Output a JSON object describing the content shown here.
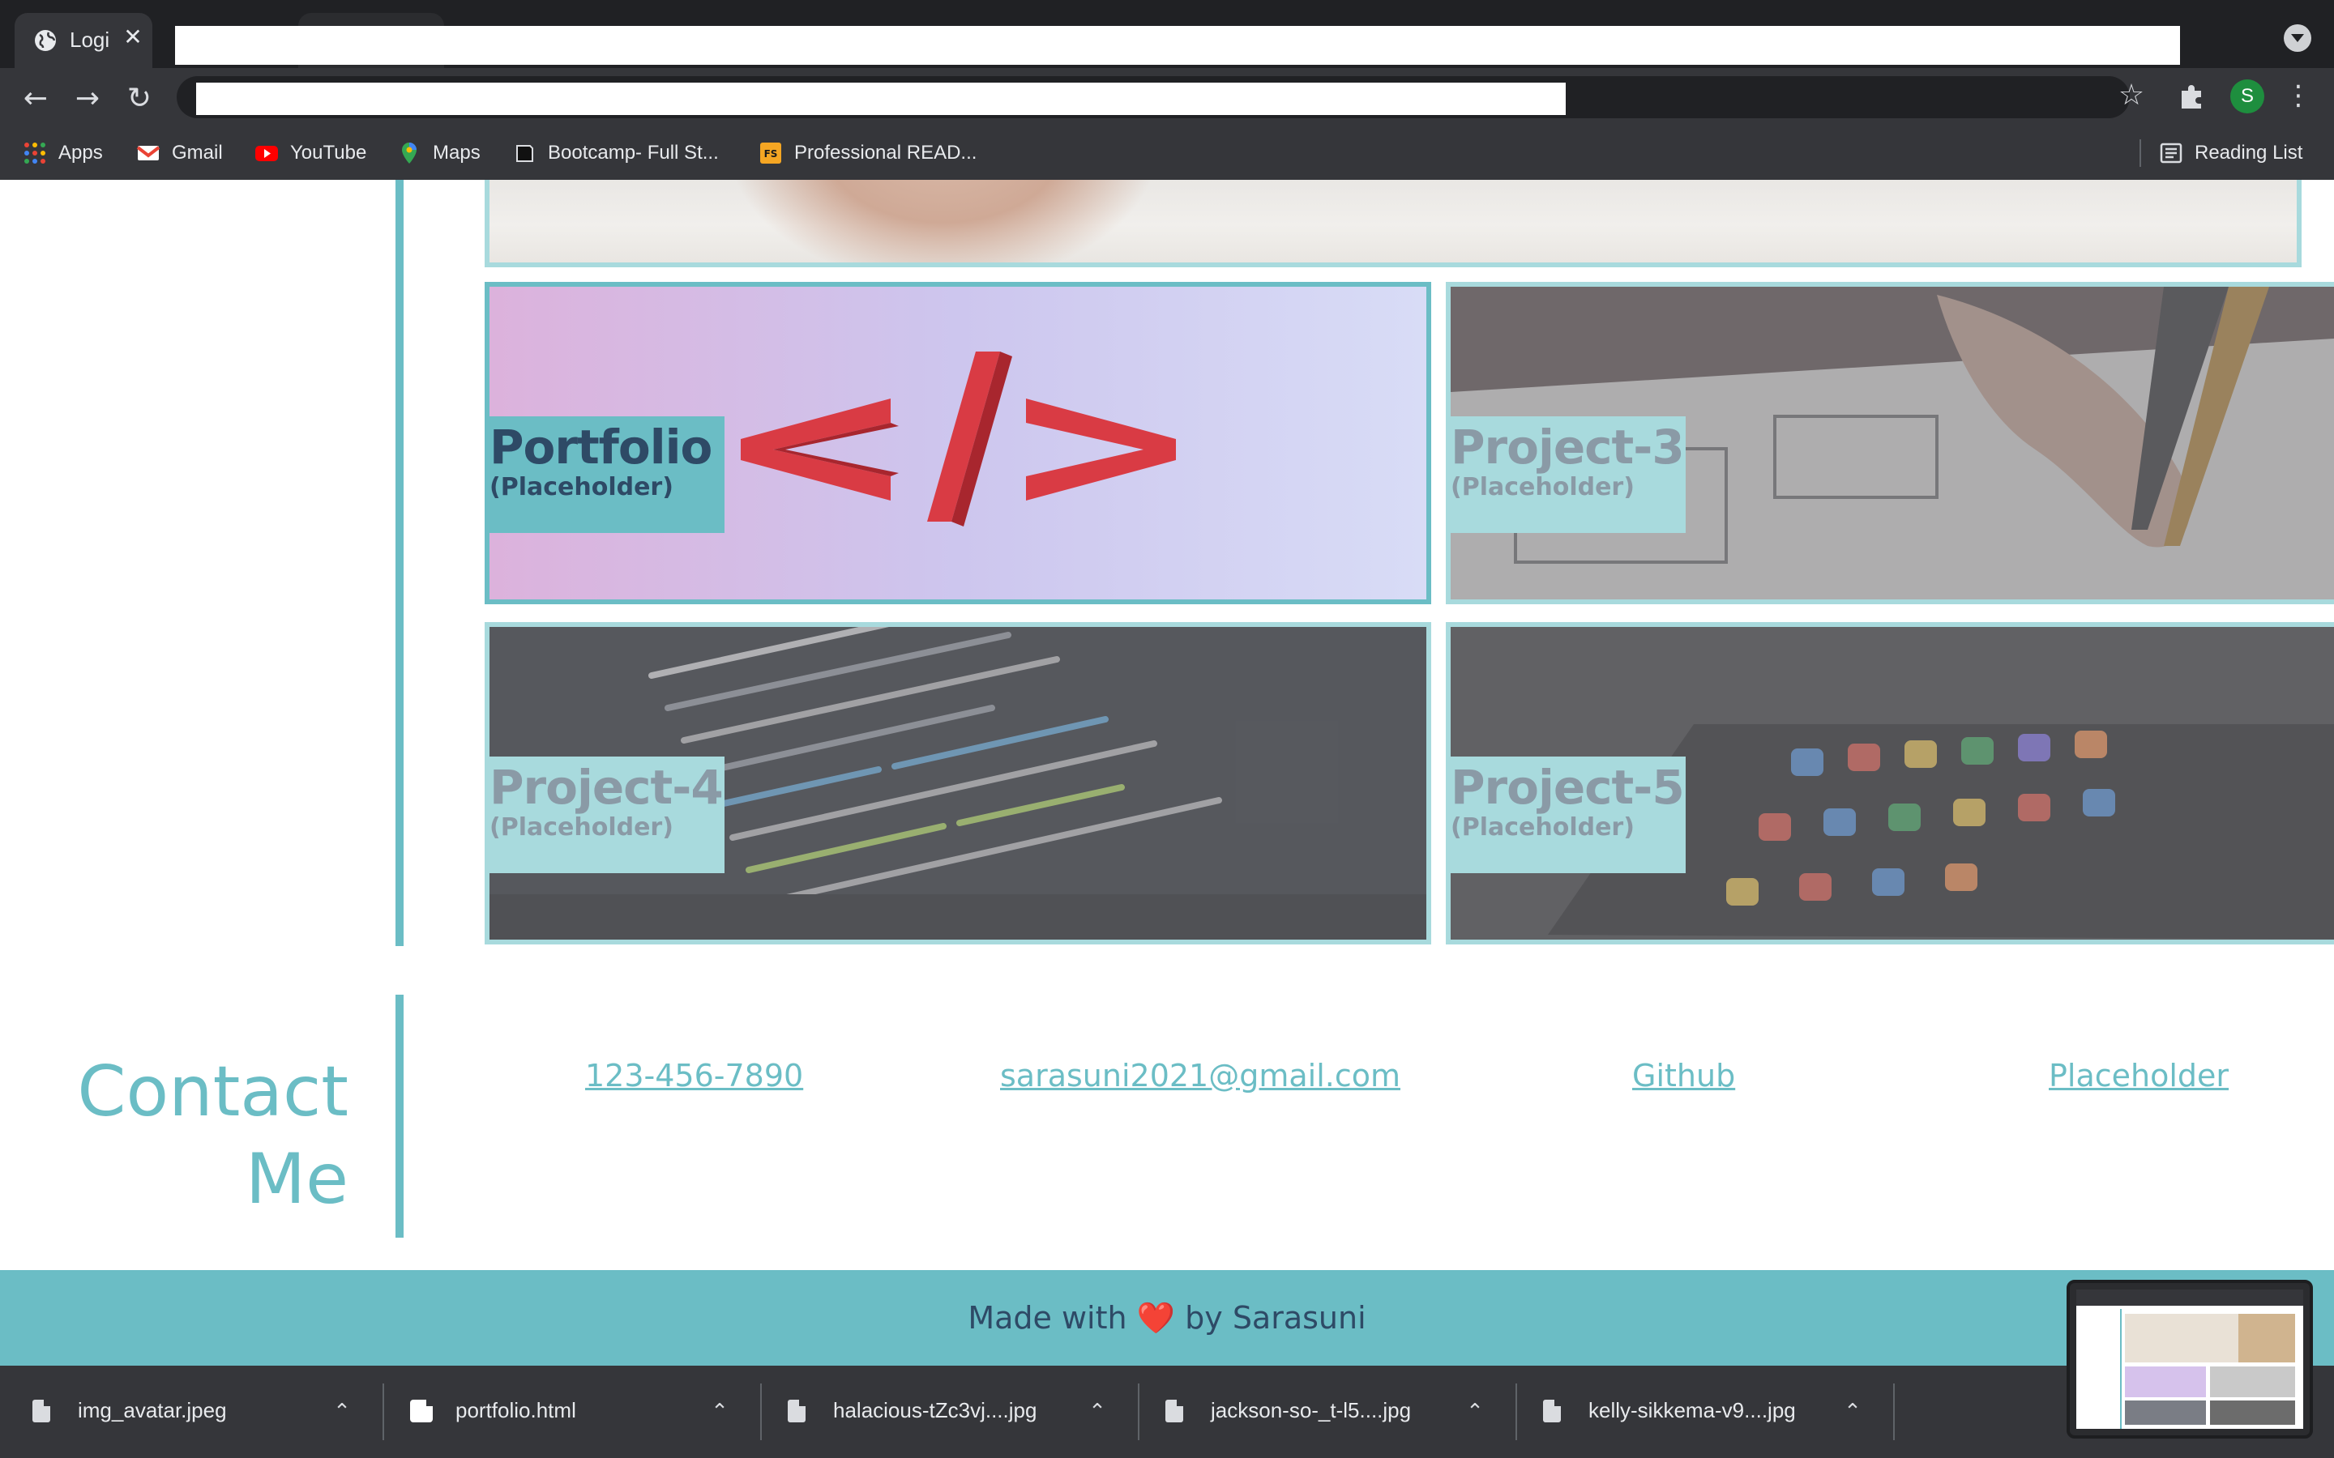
{
  "browser": {
    "tab": {
      "title": "Logi",
      "icon": "globe-icon",
      "close": "✕"
    },
    "nav": {
      "back": "←",
      "forward": "→",
      "reload": "↻"
    },
    "profile_initial": "S",
    "bookmarks": [
      {
        "label": "Apps",
        "icon": "apps-grid-icon"
      },
      {
        "label": "Gmail",
        "icon": "gmail-icon"
      },
      {
        "label": "YouTube",
        "icon": "youtube-icon"
      },
      {
        "label": "Maps",
        "icon": "maps-icon"
      },
      {
        "label": "Bootcamp- Full St...",
        "icon": "bootcamp-icon"
      },
      {
        "label": "Professional READ...",
        "icon": "fs-icon"
      }
    ],
    "reading_list": "Reading List"
  },
  "work": {
    "cards": [
      {
        "title": "Portfolio",
        "subtitle": "(Placeholder)"
      },
      {
        "title": "Project-3",
        "subtitle": "(Placeholder)"
      },
      {
        "title": "Project-4",
        "subtitle": "(Placeholder)"
      },
      {
        "title": "Project-5",
        "subtitle": "(Placeholder)"
      }
    ]
  },
  "contact": {
    "heading_line1": "Contact",
    "heading_line2": "Me",
    "links": [
      "123-456-7890",
      "sarasuni2021@gmail.com",
      "Github",
      "Placeholder"
    ]
  },
  "footer": {
    "before": "Made with",
    "heart": "❤️",
    "after": "by Sarasuni"
  },
  "downloads": [
    {
      "name": "img_avatar.jpeg",
      "type": "file"
    },
    {
      "name": "portfolio.html",
      "type": "chrome"
    },
    {
      "name": "halacious-tZc3vj....jpg",
      "type": "file"
    },
    {
      "name": "jackson-so-_t-l5....jpg",
      "type": "file"
    },
    {
      "name": "kelly-sikkema-v9....jpg",
      "type": "file"
    }
  ],
  "colors": {
    "accent": "#6bbdc5",
    "accent_light": "#a8dadd",
    "text_dark": "#2e4a66"
  }
}
